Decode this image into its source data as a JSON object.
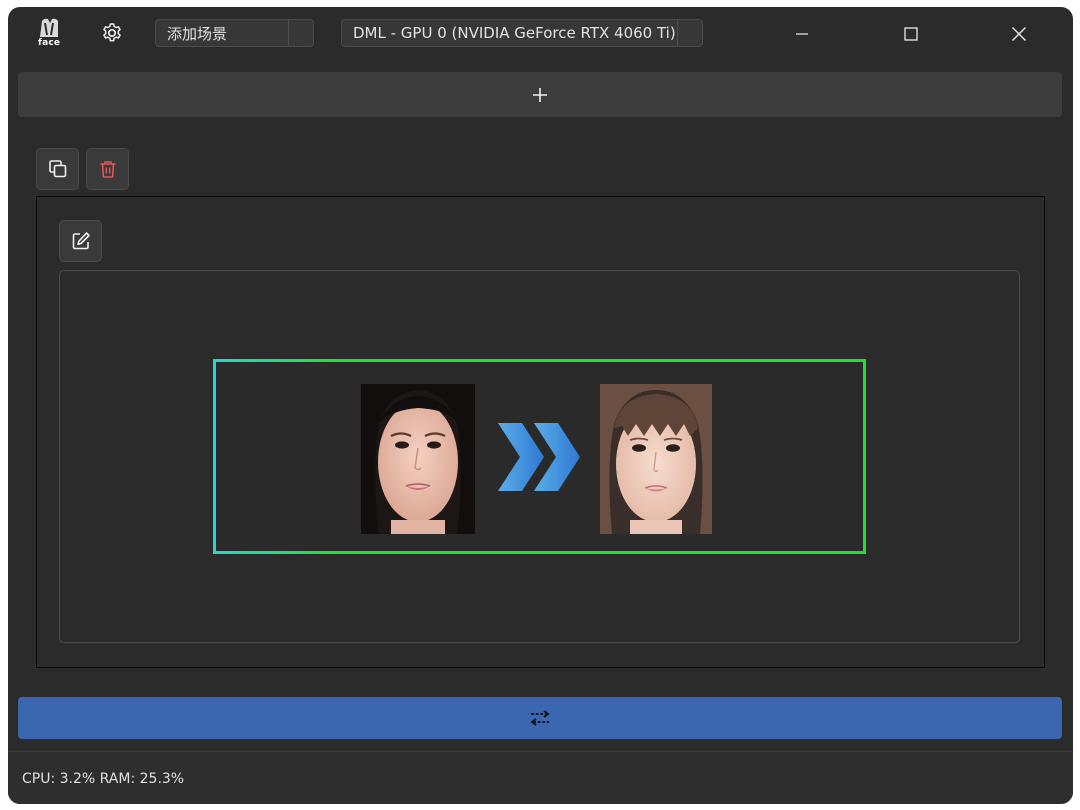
{
  "app": {
    "logo_text": "face"
  },
  "toolbar": {
    "scene_combo": {
      "value": "添加场景"
    },
    "device_combo": {
      "value": "DML - GPU 0 (NVIDIA GeForce RTX 4060 Ti)"
    }
  },
  "window_controls": {
    "minimize": "minimize-icon",
    "maximize": "maximize-icon",
    "close": "close-icon"
  },
  "icons": {
    "settings": "gear-icon",
    "add": "plus-icon",
    "copy": "copy-icon",
    "delete": "trash-icon",
    "edit": "edit-icon",
    "convert": "swap-arrows-icon",
    "transfer_arrow": "double-chevron-right-icon"
  },
  "colors": {
    "window_bg": "#2b2b2b",
    "accent_blue": "#3b67b1",
    "delete_red": "#e05454",
    "frame_green": "#22e032",
    "frame_cyan": "#22d8d0",
    "arrow_blue": "#3d8ee0"
  },
  "status": {
    "text": "CPU: 3.2%  RAM: 25.3%"
  }
}
